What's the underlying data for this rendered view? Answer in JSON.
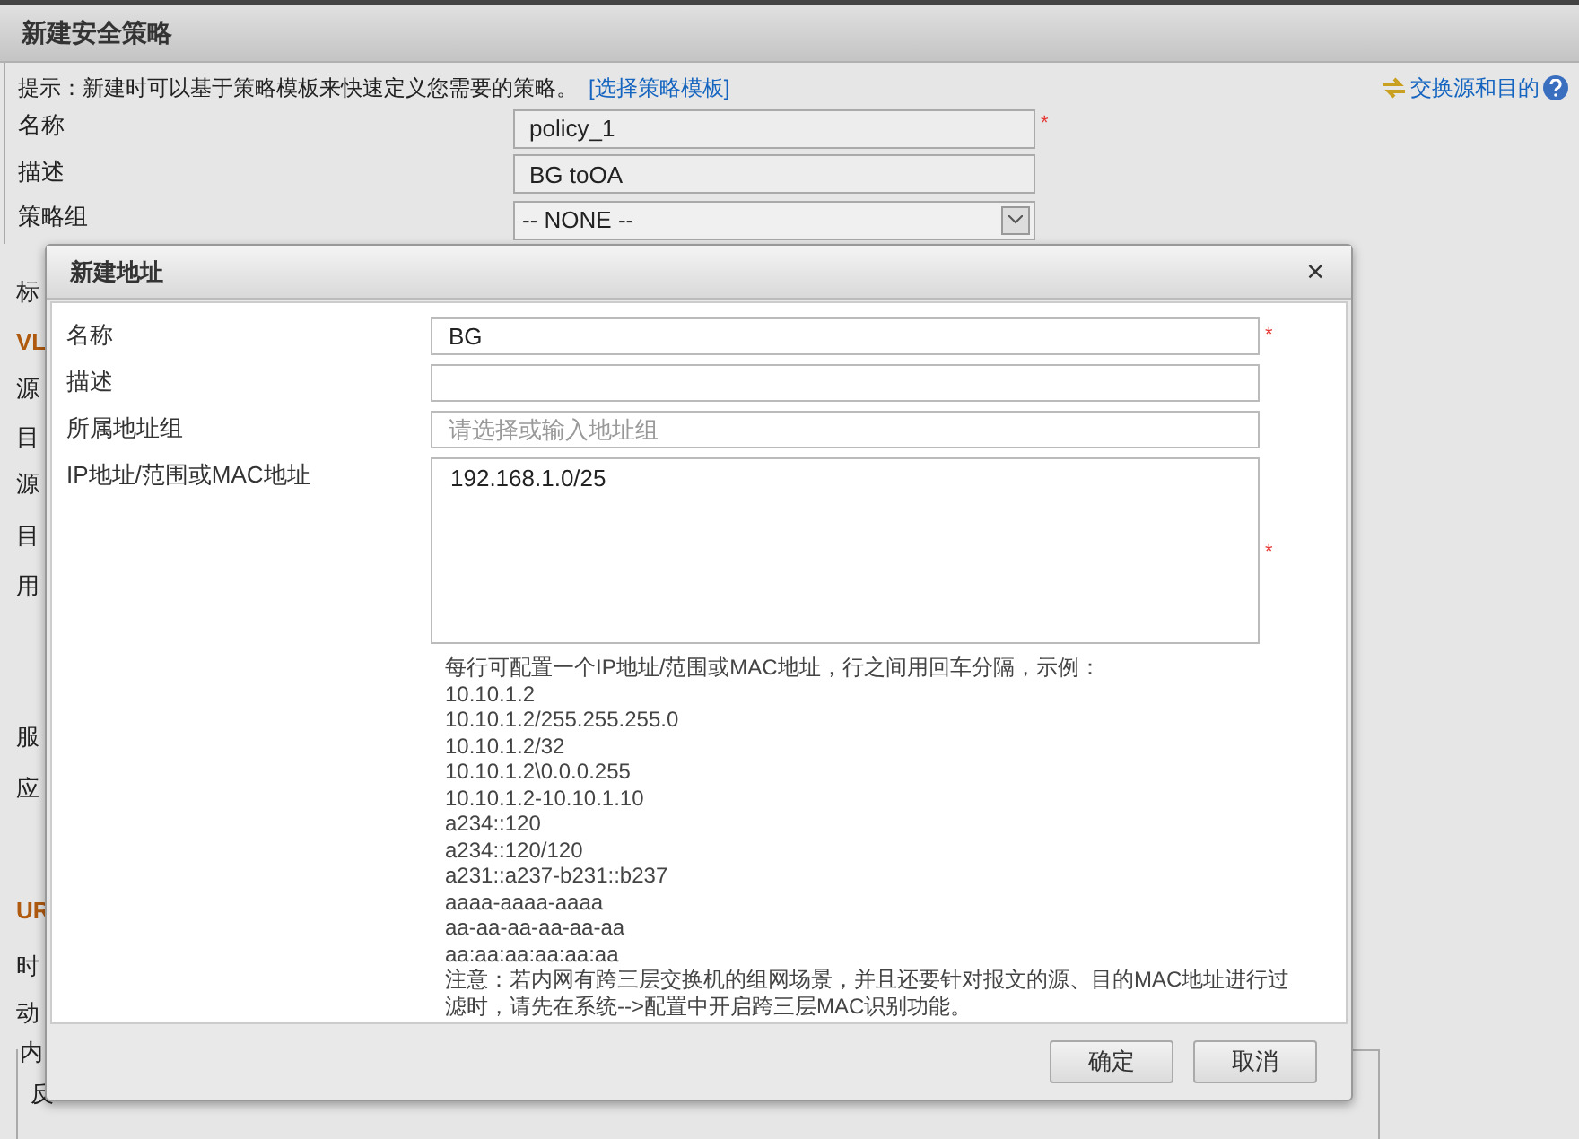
{
  "page": {
    "title": "新建安全策略",
    "tip": "提示：新建时可以基于策略模板来快速定义您需要的策略。",
    "tip_link": "[选择策略模板]",
    "swap_link": "交换源和目的",
    "fields": [
      {
        "kind": "input",
        "label": "名称",
        "value": "policy_1",
        "required_mark": "*"
      },
      {
        "kind": "input",
        "label": "描述",
        "value": "BG toOA"
      },
      {
        "kind": "select",
        "label": "策略组",
        "value": "-- NONE --"
      }
    ],
    "hidden_labels": [
      {
        "text": "标",
        "section": false
      },
      {
        "text": "VL",
        "section": true
      },
      {
        "text": "源",
        "section": false
      },
      {
        "text": "目",
        "section": false
      },
      {
        "text": "源",
        "section": false
      },
      {
        "text": "目",
        "section": false
      },
      {
        "text": "用",
        "section": false
      },
      {
        "text": "服",
        "section": false
      },
      {
        "text": "应",
        "section": false
      },
      {
        "text": "UR",
        "section": true
      },
      {
        "text": "时",
        "section": false
      },
      {
        "text": "动",
        "section": false
      }
    ],
    "group_box": {
      "legend": "内",
      "label": "反"
    }
  },
  "dialog": {
    "title": "新建地址",
    "close": "×",
    "fields": [
      {
        "kind": "input",
        "label": "名称",
        "value": "BG",
        "required_mark": "*"
      },
      {
        "kind": "input",
        "label": "描述"
      },
      {
        "kind": "input",
        "label": "所属地址组",
        "placeholder": "请选择或输入地址组"
      },
      {
        "kind": "textarea",
        "label": "IP地址/范围或MAC地址",
        "value": "192.168.1.0/25",
        "required_mark": "*"
      }
    ],
    "help_lines": [
      "每行可配置一个IP地址/范围或MAC地址，行之间用回车分隔，示例：",
      "10.10.1.2",
      "10.10.1.2/255.255.255.0",
      "10.10.1.2/32",
      "10.10.1.2\\0.0.0.255",
      "10.10.1.2-10.10.1.10",
      "a234::120",
      "a234::120/120",
      "a231::a237-b231::b237",
      "aaaa-aaaa-aaaa",
      "aa-aa-aa-aa-aa-aa",
      "aa:aa:aa:aa:aa:aa"
    ],
    "note": "注意：若内网有跨三层交换机的组网场景，并且还要针对报文的源、目的MAC地址进行过滤时，请先在系统-->配置中开启跨三层MAC识别功能。",
    "buttons": [
      "确定",
      "取消"
    ]
  }
}
